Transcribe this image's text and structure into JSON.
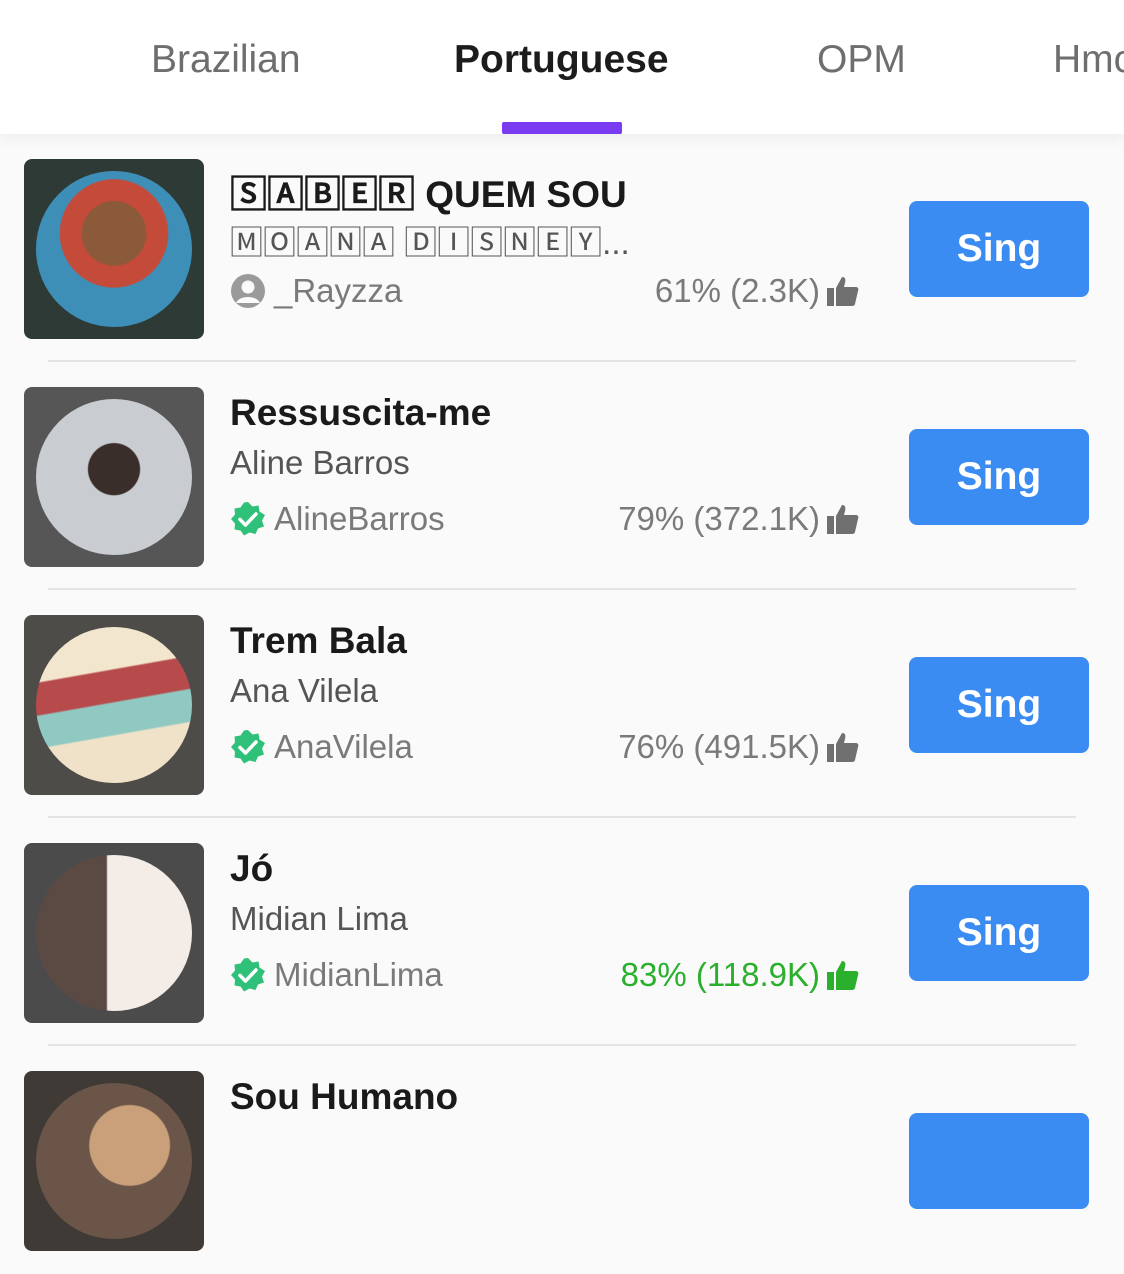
{
  "tabs": [
    {
      "label": "Brazilian",
      "active": false
    },
    {
      "label": "Portuguese",
      "active": true
    },
    {
      "label": "OPM",
      "active": false
    },
    {
      "label": "Hmo",
      "active": false
    }
  ],
  "accent_color": "#7a3cf0",
  "button_color": "#3b8cf2",
  "songs": [
    {
      "title": "🅂🄰🄱🄴🅁 QUEM SOU",
      "artist": "🄼🄾🄰🄽🄰 🄳🄸🅂🄽🄴🅈...",
      "uploader": "_Rayzza",
      "uploader_icon": "user-avatar-icon",
      "rating": "61% (2.3K)",
      "sing_label": "Sing"
    },
    {
      "title": "Ressuscita-me",
      "artist": "Aline Barros",
      "uploader": "AlineBarros",
      "uploader_icon": "verified-badge-icon",
      "rating": "79% (372.1K)",
      "sing_label": "Sing"
    },
    {
      "title": "Trem Bala",
      "artist": "Ana Vilela",
      "uploader": "AnaVilela",
      "uploader_icon": "verified-badge-icon",
      "rating": "76% (491.5K)",
      "sing_label": "Sing"
    },
    {
      "title": "Jó",
      "artist": "Midian Lima",
      "uploader": "MidianLima",
      "uploader_icon": "verified-badge-icon",
      "rating": "83% (118.9K)",
      "sing_label": "Sing"
    },
    {
      "title": "Sou Humano",
      "artist": "",
      "uploader": "",
      "uploader_icon": "",
      "rating": "",
      "sing_label": ""
    }
  ]
}
